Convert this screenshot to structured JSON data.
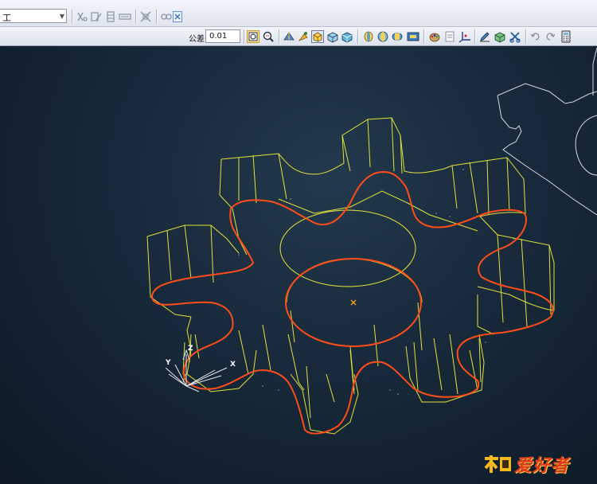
{
  "toolbar_top": {
    "combo_value": "工",
    "icons": [
      "clip-icon",
      "edit-icon",
      "layer-icon",
      "list-icon",
      "move-icon",
      "link-icon"
    ]
  },
  "toolbar_second": {
    "tolerance_label": "公差",
    "tolerance_value": "0.01",
    "icons": [
      "pattern-icon",
      "search-icon",
      "fold-icon",
      "tool-icon",
      "block-icon",
      "wire-icon",
      "shaded-icon",
      "solid-icon",
      "front-view-icon",
      "side-view-icon",
      "top-view-icon",
      "frame-icon",
      "palette-icon",
      "note-icon",
      "axis-icon",
      "pen-icon",
      "box-icon",
      "scissor-icon",
      "undo-icon",
      "redo-icon",
      "calculator-icon"
    ]
  },
  "viewport": {
    "axis_labels": {
      "x": "X",
      "y": "Y",
      "z": "Z"
    },
    "model_colors": {
      "wire": "#e2e23a",
      "edge": "#ff4d1a",
      "sketch": "#cfd6dd"
    }
  },
  "watermark": {
    "text": "爱好者"
  }
}
